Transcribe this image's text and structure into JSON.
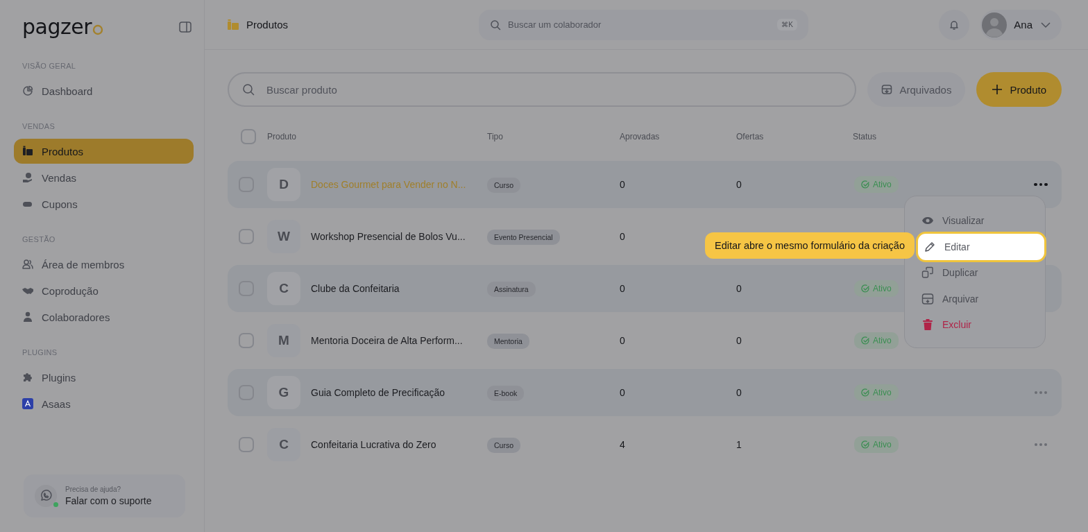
{
  "sidebar": {
    "logo": "pagzer",
    "sections": [
      {
        "title": "VISÃO GERAL",
        "items": [
          {
            "label": "Dashboard",
            "selected": false
          }
        ]
      },
      {
        "title": "VENDAS",
        "items": [
          {
            "label": "Produtos",
            "selected": true
          },
          {
            "label": "Vendas",
            "selected": false
          },
          {
            "label": "Cupons",
            "selected": false
          }
        ]
      },
      {
        "title": "GESTÃO",
        "items": [
          {
            "label": "Área de membros",
            "selected": false
          },
          {
            "label": "Coprodução",
            "selected": false
          },
          {
            "label": "Colaboradores",
            "selected": false
          }
        ]
      },
      {
        "title": "PLUGINS",
        "items": [
          {
            "label": "Plugins",
            "selected": false
          },
          {
            "label": "Asaas",
            "selected": false
          }
        ]
      }
    ],
    "help": {
      "hint": "Precisa de ajuda?",
      "label": "Falar com o suporte",
      "online": true
    }
  },
  "topbar": {
    "title": "Produtos",
    "search": {
      "placeholder": "Buscar um colaborador",
      "shortcut": "⌘K"
    },
    "user": {
      "name": "Ana"
    }
  },
  "toolbar": {
    "search": {
      "placeholder": "Buscar produto"
    },
    "buttons": [
      {
        "label": "Arquivados",
        "kind": "secondary"
      },
      {
        "label": "Produto",
        "kind": "primary"
      }
    ]
  },
  "table": {
    "select_all_checked": false,
    "columns": [
      "Produto",
      "Tipo",
      "Aprovadas",
      "Ofertas",
      "Status"
    ],
    "rows": [
      {
        "letter": "D",
        "name": "Doces Gourmet para Vender no N...",
        "type": "Curso",
        "approved": "0",
        "offers": "0",
        "status": "Ativo",
        "checked": false,
        "active": true,
        "menu_button": true
      },
      {
        "letter": "W",
        "name": "Workshop Presencial de Bolos Vu...",
        "type": "Evento Presencial",
        "approved": "0",
        "checked": false,
        "active": false,
        "menu_button": false
      },
      {
        "letter": "C",
        "name": "Clube da Confeitaria",
        "type": "Assinatura",
        "approved": "0",
        "offers": "0",
        "status": "Ativo",
        "checked": false,
        "active": false,
        "menu_button": false
      },
      {
        "letter": "M",
        "name": "Mentoria Doceira de Alta Perform...",
        "type": "Mentoria",
        "approved": "0",
        "offers": "0",
        "status": "Ativo",
        "checked": false,
        "active": false,
        "menu_button": false
      },
      {
        "letter": "G",
        "name": "Guia Completo de Precificação",
        "type": "E-book",
        "approved": "0",
        "offers": "0",
        "status": "Ativo",
        "checked": false,
        "active": false,
        "menu_button": true
      },
      {
        "letter": "C",
        "name": "Confeitaria Lucrativa do Zero",
        "type": "Curso",
        "approved": "4",
        "offers": "1",
        "status": "Ativo",
        "checked": false,
        "active": false,
        "menu_button": true
      }
    ]
  },
  "menu": {
    "items": [
      {
        "label": "Visualizar",
        "kind": "normal",
        "selected": false
      },
      {
        "label": "Editar",
        "kind": "normal",
        "selected": true
      },
      {
        "label": "Duplicar",
        "kind": "normal",
        "selected": false
      },
      {
        "label": "Arquivar",
        "kind": "normal",
        "selected": false
      },
      {
        "label": "Excluir",
        "kind": "danger",
        "selected": false
      }
    ]
  },
  "tooltip": {
    "text": "Editar abre o mesmo formulário da criação"
  }
}
